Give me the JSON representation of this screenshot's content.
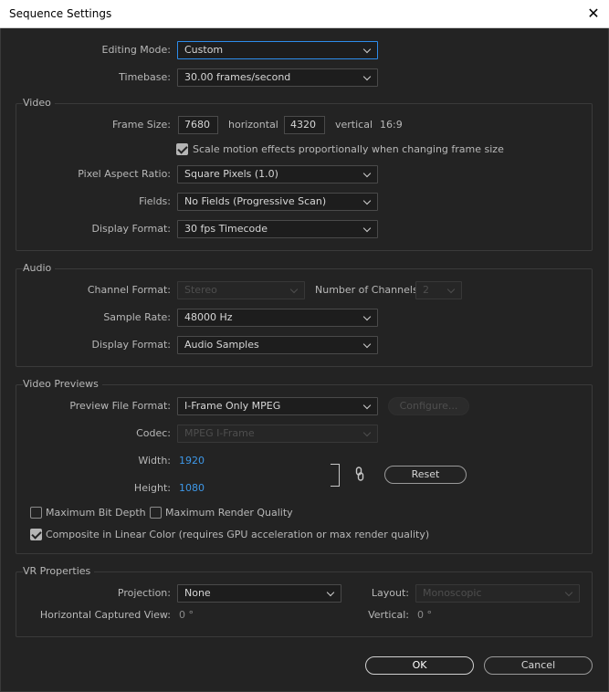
{
  "window": {
    "title": "Sequence Settings",
    "close_glyph": "✕"
  },
  "general": {
    "editing_mode_label": "Editing Mode:",
    "editing_mode_value": "Custom",
    "timebase_label": "Timebase:",
    "timebase_value": "30.00  frames/second"
  },
  "video": {
    "section_title": "Video",
    "frame_size_label": "Frame Size:",
    "width_value": "7680",
    "horizontal_label": "horizontal",
    "height_value": "4320",
    "vertical_label": "vertical",
    "aspect": "16:9",
    "scale_checkbox_label": "Scale motion effects proportionally when changing frame size",
    "scale_checked": true,
    "pixel_aspect_label": "Pixel Aspect Ratio:",
    "pixel_aspect_value": "Square Pixels (1.0)",
    "fields_label": "Fields:",
    "fields_value": "No Fields (Progressive Scan)",
    "display_format_label": "Display Format:",
    "display_format_value": "30 fps Timecode"
  },
  "audio": {
    "section_title": "Audio",
    "channel_format_label": "Channel Format:",
    "channel_format_value": "Stereo",
    "num_channels_label": "Number of Channels:",
    "num_channels_value": "2",
    "sample_rate_label": "Sample Rate:",
    "sample_rate_value": "48000 Hz",
    "display_format_label": "Display Format:",
    "display_format_value": "Audio Samples"
  },
  "previews": {
    "section_title": "Video Previews",
    "preview_format_label": "Preview File Format:",
    "preview_format_value": "I-Frame Only MPEG",
    "configure_label": "Configure...",
    "codec_label": "Codec:",
    "codec_value": "MPEG I-Frame",
    "width_label": "Width:",
    "width_value": "1920",
    "height_label": "Height:",
    "height_value": "1080",
    "reset_label": "Reset",
    "max_bit_depth_label": "Maximum Bit Depth",
    "max_bit_depth_checked": false,
    "max_render_quality_label": "Maximum Render Quality",
    "max_render_quality_checked": false,
    "linear_color_label": "Composite in Linear Color (requires GPU acceleration or max render quality)",
    "linear_color_checked": true
  },
  "vr": {
    "section_title": "VR Properties",
    "projection_label": "Projection:",
    "projection_value": "None",
    "layout_label": "Layout:",
    "layout_value": "Monoscopic",
    "h_captured_label": "Horizontal Captured View:",
    "h_captured_value": "0 °",
    "vertical_label": "Vertical:",
    "vertical_value": "0 °"
  },
  "footer": {
    "ok_label": "OK",
    "cancel_label": "Cancel"
  },
  "icons": {
    "link": "chain-link-icon",
    "checkmark": "checkmark-icon",
    "chevron": "chevron-down-icon",
    "close": "close-icon"
  }
}
